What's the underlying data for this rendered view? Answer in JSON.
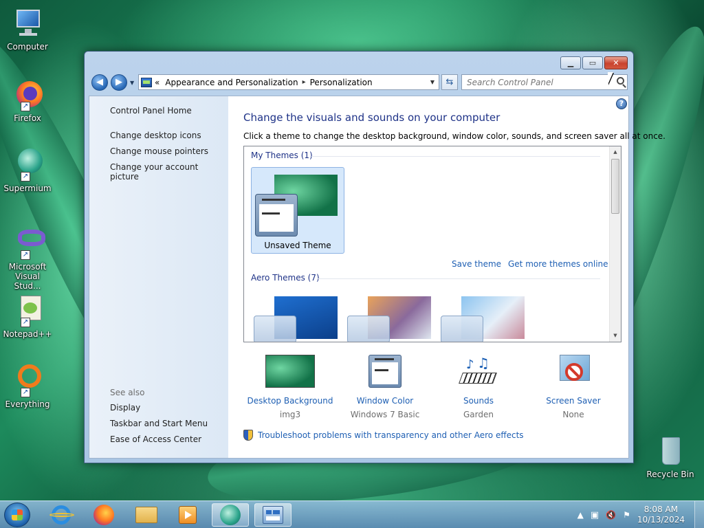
{
  "desktop": {
    "icons": [
      {
        "label": "Computer"
      },
      {
        "label": "Firefox"
      },
      {
        "label": "Supermium"
      },
      {
        "label": "Microsoft Visual Stud..."
      },
      {
        "label": "Notepad++"
      },
      {
        "label": "Everything"
      },
      {
        "label": "Recycle Bin"
      }
    ]
  },
  "window": {
    "breadcrumb": {
      "prefix": "«",
      "items": [
        "Appearance and Personalization",
        "Personalization"
      ],
      "separator": "▸"
    },
    "search": {
      "placeholder": "Search Control Panel"
    },
    "left_pane": {
      "home": "Control Panel Home",
      "links": [
        "Change desktop icons",
        "Change mouse pointers",
        "Change your account picture"
      ],
      "see_also_label": "See also",
      "see_also": [
        "Display",
        "Taskbar and Start Menu",
        "Ease of Access Center"
      ]
    },
    "main": {
      "title": "Change the visuals and sounds on your computer",
      "description": "Click a theme to change the desktop background, window color, sounds, and screen saver all at once.",
      "my_themes_label": "My Themes (1)",
      "unsaved_theme": "Unsaved Theme",
      "save_theme": "Save theme",
      "get_more": "Get more themes online",
      "aero_themes_label": "Aero Themes (7)",
      "bottom": [
        {
          "title": "Desktop Background",
          "value": "img3",
          "icon": "desktop-background-icon"
        },
        {
          "title": "Window Color",
          "value": "Windows 7 Basic",
          "icon": "window-color-icon"
        },
        {
          "title": "Sounds",
          "value": "Garden",
          "icon": "sounds-icon"
        },
        {
          "title": "Screen Saver",
          "value": "None",
          "icon": "screen-saver-icon"
        }
      ],
      "troubleshoot": "Troubleshoot problems with transparency and other Aero effects"
    }
  },
  "taskbar": {
    "clock_time": "8:08 AM",
    "clock_date": "10/13/2024"
  }
}
